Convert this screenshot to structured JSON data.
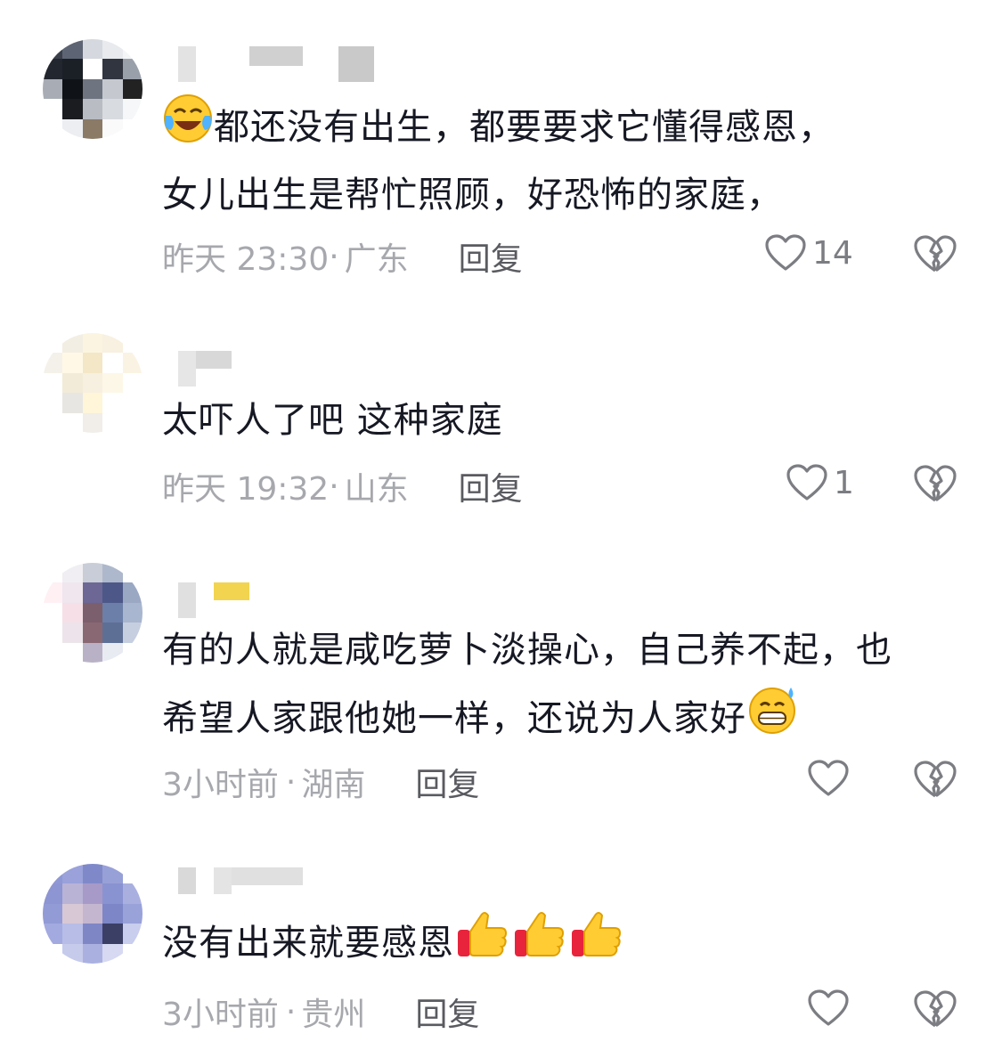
{
  "comments": [
    {
      "lines": [
        "都还没有出生，都要要求它懂得感恩，",
        "女儿出生是帮忙照顾，好恐怖的家庭，"
      ],
      "time": "昨天 23:30",
      "location": "广东",
      "reply_label": "回复",
      "likes": "14"
    },
    {
      "lines": [
        "太吓人了吧 这种家庭"
      ],
      "time": "昨天 19:32",
      "location": "山东",
      "reply_label": "回复",
      "likes": "1"
    },
    {
      "lines": [
        "有的人就是咸吃萝卜淡操心，自己养不起，也",
        "希望人家跟他她一样，还说为人家好"
      ],
      "time": "3小时前",
      "location": "湖南",
      "reply_label": "回复",
      "likes": ""
    },
    {
      "lines": [
        "没有出来就要感恩"
      ],
      "time": "3小时前",
      "location": "贵州",
      "reply_label": "回复",
      "likes": ""
    }
  ],
  "meta_separator": "·",
  "icons": {
    "like": "heart-outline-icon",
    "dislike": "broken-heart-icon",
    "emoji_1": "laughing-crying-emoji",
    "emoji_3": "grimacing-sweat-emoji",
    "emoji_4": "thumbs-up-emoji"
  },
  "colors": {
    "text": "#161823",
    "meta": "#a7a8ad",
    "reply": "#5a5b60",
    "icon": "#7c7d82"
  }
}
